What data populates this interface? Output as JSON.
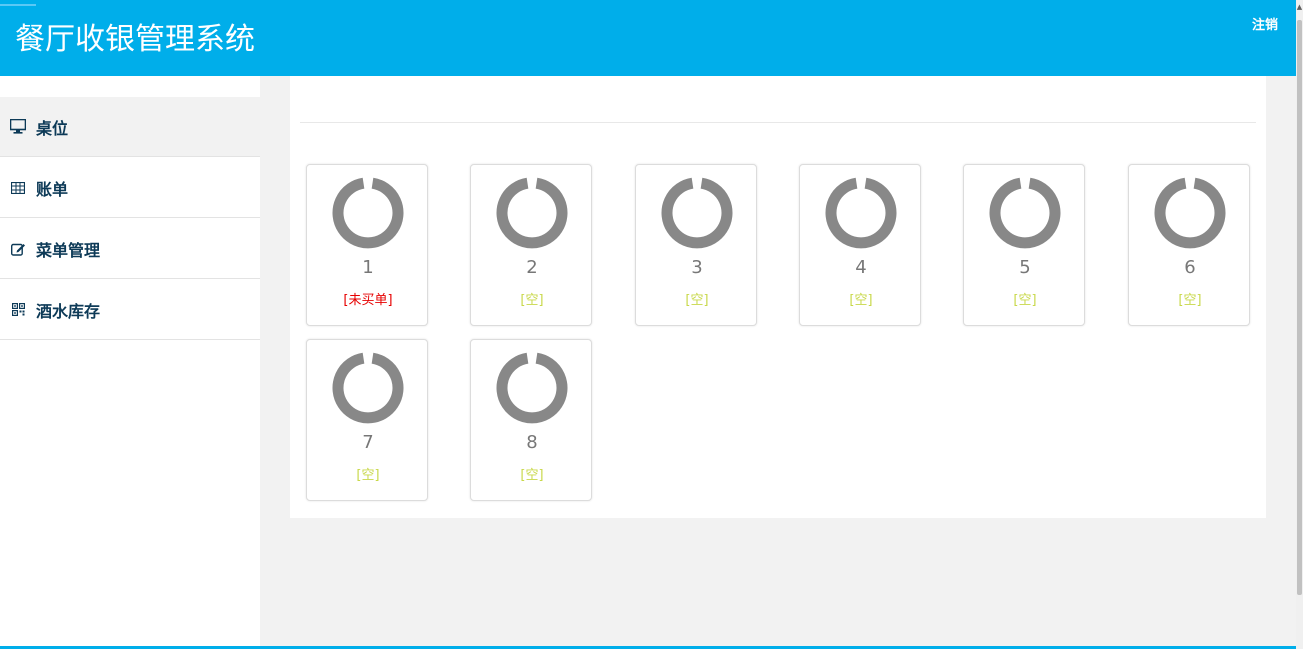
{
  "header": {
    "title": "餐厅收银管理系统",
    "logout_label": "注销"
  },
  "sidebar": {
    "items": [
      {
        "label": "桌位",
        "icon": "monitor-icon",
        "active": true
      },
      {
        "label": "账单",
        "icon": "table-icon",
        "active": false
      },
      {
        "label": "菜单管理",
        "icon": "edit-icon",
        "active": false
      },
      {
        "label": "酒水库存",
        "icon": "qrcode-icon",
        "active": false
      }
    ]
  },
  "tables": [
    {
      "number": "1",
      "status": "[未买单]",
      "status_color": "#e60000"
    },
    {
      "number": "2",
      "status": "[空]",
      "status_color": "#c8d84a"
    },
    {
      "number": "3",
      "status": "[空]",
      "status_color": "#c8d84a"
    },
    {
      "number": "4",
      "status": "[空]",
      "status_color": "#c8d84a"
    },
    {
      "number": "5",
      "status": "[空]",
      "status_color": "#c8d84a"
    },
    {
      "number": "6",
      "status": "[空]",
      "status_color": "#c8d84a"
    },
    {
      "number": "7",
      "status": "[空]",
      "status_color": "#c8d84a"
    },
    {
      "number": "8",
      "status": "[空]",
      "status_color": "#c8d84a"
    }
  ],
  "colors": {
    "header_bg": "#00aeea",
    "ring": "#888888",
    "sidebar_text": "#0d3a57"
  }
}
